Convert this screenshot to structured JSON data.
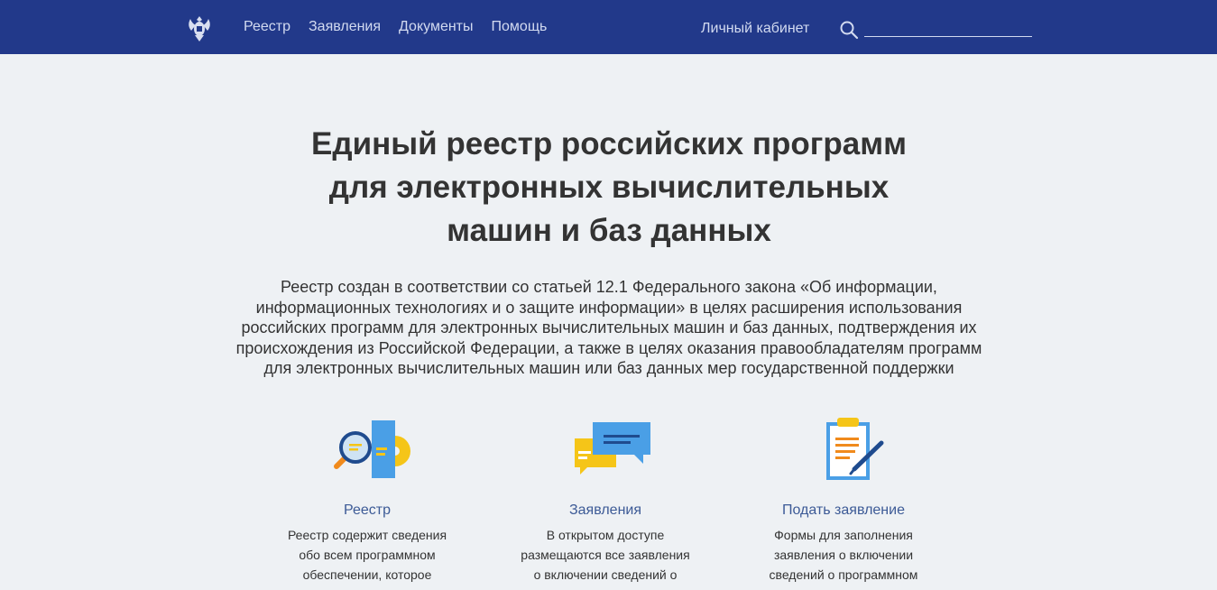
{
  "header": {
    "nav": [
      "Реестр",
      "Заявления",
      "Документы",
      "Помощь"
    ],
    "cabinet": "Личный кабинет",
    "search": {
      "value": "",
      "placeholder": ""
    }
  },
  "hero": {
    "title": "Единый реестр российских программ\nдля электронных вычислительных\nмашин и баз данных",
    "description": "Реестр создан в соответствии со статьей 12.1 Федерального закона «Об информации,\nинформационных технологиях и о защите информации» в целях расширения использования\nроссийских программ для электронных вычислительных машин и баз данных, подтверждения их\nпроисхождения из Российской Федерации, а также в целях оказания правообладателям программ\nдля электронных вычислительных машин или баз данных мер государственной поддержки"
  },
  "features": [
    {
      "icon": "registry-icon",
      "title": "Реестр",
      "text": "Реестр содержит сведения\nобо всем программном\nобеспечении, которое"
    },
    {
      "icon": "chat-bubbles-icon",
      "title": "Заявления",
      "text": "В открытом доступе\nразмещаются все заявления\nо включении сведений о"
    },
    {
      "icon": "clipboard-pen-icon",
      "title": "Подать заявление",
      "text": "Формы для заполнения\nзаявления о включении\nсведений о программном"
    }
  ],
  "colors": {
    "header_bg": "#22398a",
    "page_bg": "#eef1f4",
    "link": "#3c5a96",
    "accent_blue": "#4a9fe6",
    "accent_yellow": "#f5c518",
    "accent_orange": "#f08a1c"
  }
}
